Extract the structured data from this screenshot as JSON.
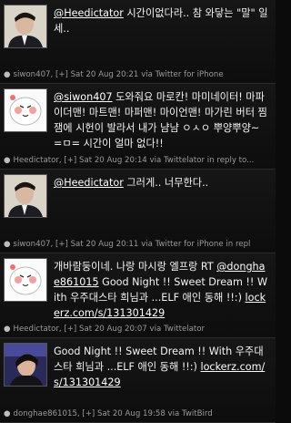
{
  "tweets": [
    {
      "mention": "@Heedictator",
      "text": " 시간이없다라.. 참 와닿는 \"말\" 일세..",
      "meta": "siwon407, [+] Sat 20 Aug 20:21 via Twitter for iPhone"
    },
    {
      "mention": "@siwon407",
      "text": " 도와줘요 마로칸! 마미네이터! 마파이더맨! 마트맨! 마퍼맨! 마이언맨! 마가린 버터 찜잼에 시헌이 발라서 내가 냠냠 ㅇㅅㅇ 뿌양뿌양~ =ㅁ= 시간이 얼마 없다!!",
      "meta": "Heedictator, [+] Sat 20 Aug 20:14 via Twittelator in reply to..."
    },
    {
      "mention": "@Heedictator",
      "text": " 그러게.. 너무한다..",
      "meta": "siwon407, [+] Sat 20 Aug 20:11 via Twitter for iPhone in repl"
    },
    {
      "prefix": "개바람둥이네. 나랑 마시랑 엘프랑 RT ",
      "mention": "@donghae861015",
      "text": " Good Night !! Sweet Dream !! With 우주대스타 희님과 ...ELF 애인 동해 !!:) ",
      "link": "lockerz.com/s/131301429",
      "meta": "Heedictator, [+] Sat 20 Aug 20:07 via Twittelator"
    },
    {
      "text": "Good Night !! Sweet Dream !! With 우주대스타 희님과 ...ELF 애인 동해 !!:) ",
      "link": "lockerz.com/s/131301429",
      "meta": "donghae861015, [+] Sat 20 Aug 19:58 via TwitBird"
    }
  ],
  "icons": {
    "bullet": "●",
    "avatar_1": "man-in-suit-avatar",
    "avatar_2": "white-cartoon-face-avatar",
    "avatar_5": "dark-hair-man-avatar"
  },
  "colors": {
    "background": "#0b0b0b",
    "meta": "#9a9a9a",
    "text": "#f4f4f4"
  }
}
